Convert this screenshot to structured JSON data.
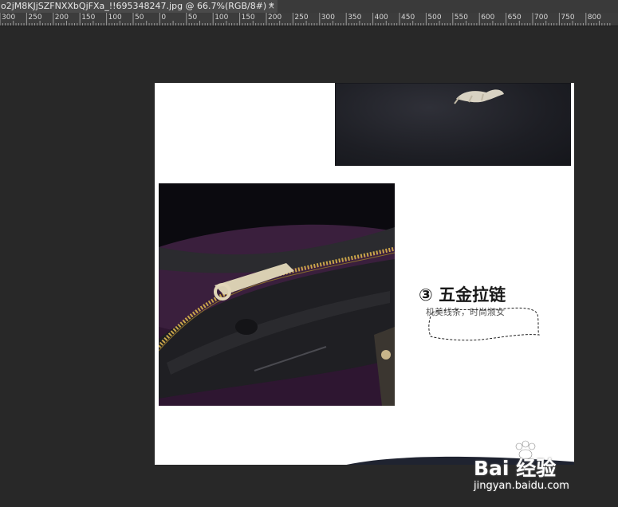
{
  "document_tab": {
    "title": "o2jM8KJjSZFNXXbQjFXa_!!695348247.jpg @ 66.7%(RGB/8#) *",
    "close_glyph": "×"
  },
  "ruler": {
    "labels": [
      "300",
      "250",
      "200",
      "150",
      "100",
      "50",
      "0",
      "50",
      "100",
      "150",
      "200",
      "250",
      "300",
      "350",
      "400",
      "450",
      "500",
      "550",
      "600",
      "650",
      "700",
      "750",
      "800"
    ]
  },
  "canvas": {
    "heading": "③ 五金拉链",
    "subtext": "机美线条，时尚淑女"
  },
  "watermark": {
    "logo": "Bai 经验",
    "url": "jingyan.baidu.com",
    "icon": "baidu-paw-icon"
  },
  "colors": {
    "workspace": "#282828",
    "ruler_bg": "#3c3c3c",
    "tab_bg": "#4a4a4a",
    "canvas_bg": "#ffffff"
  }
}
